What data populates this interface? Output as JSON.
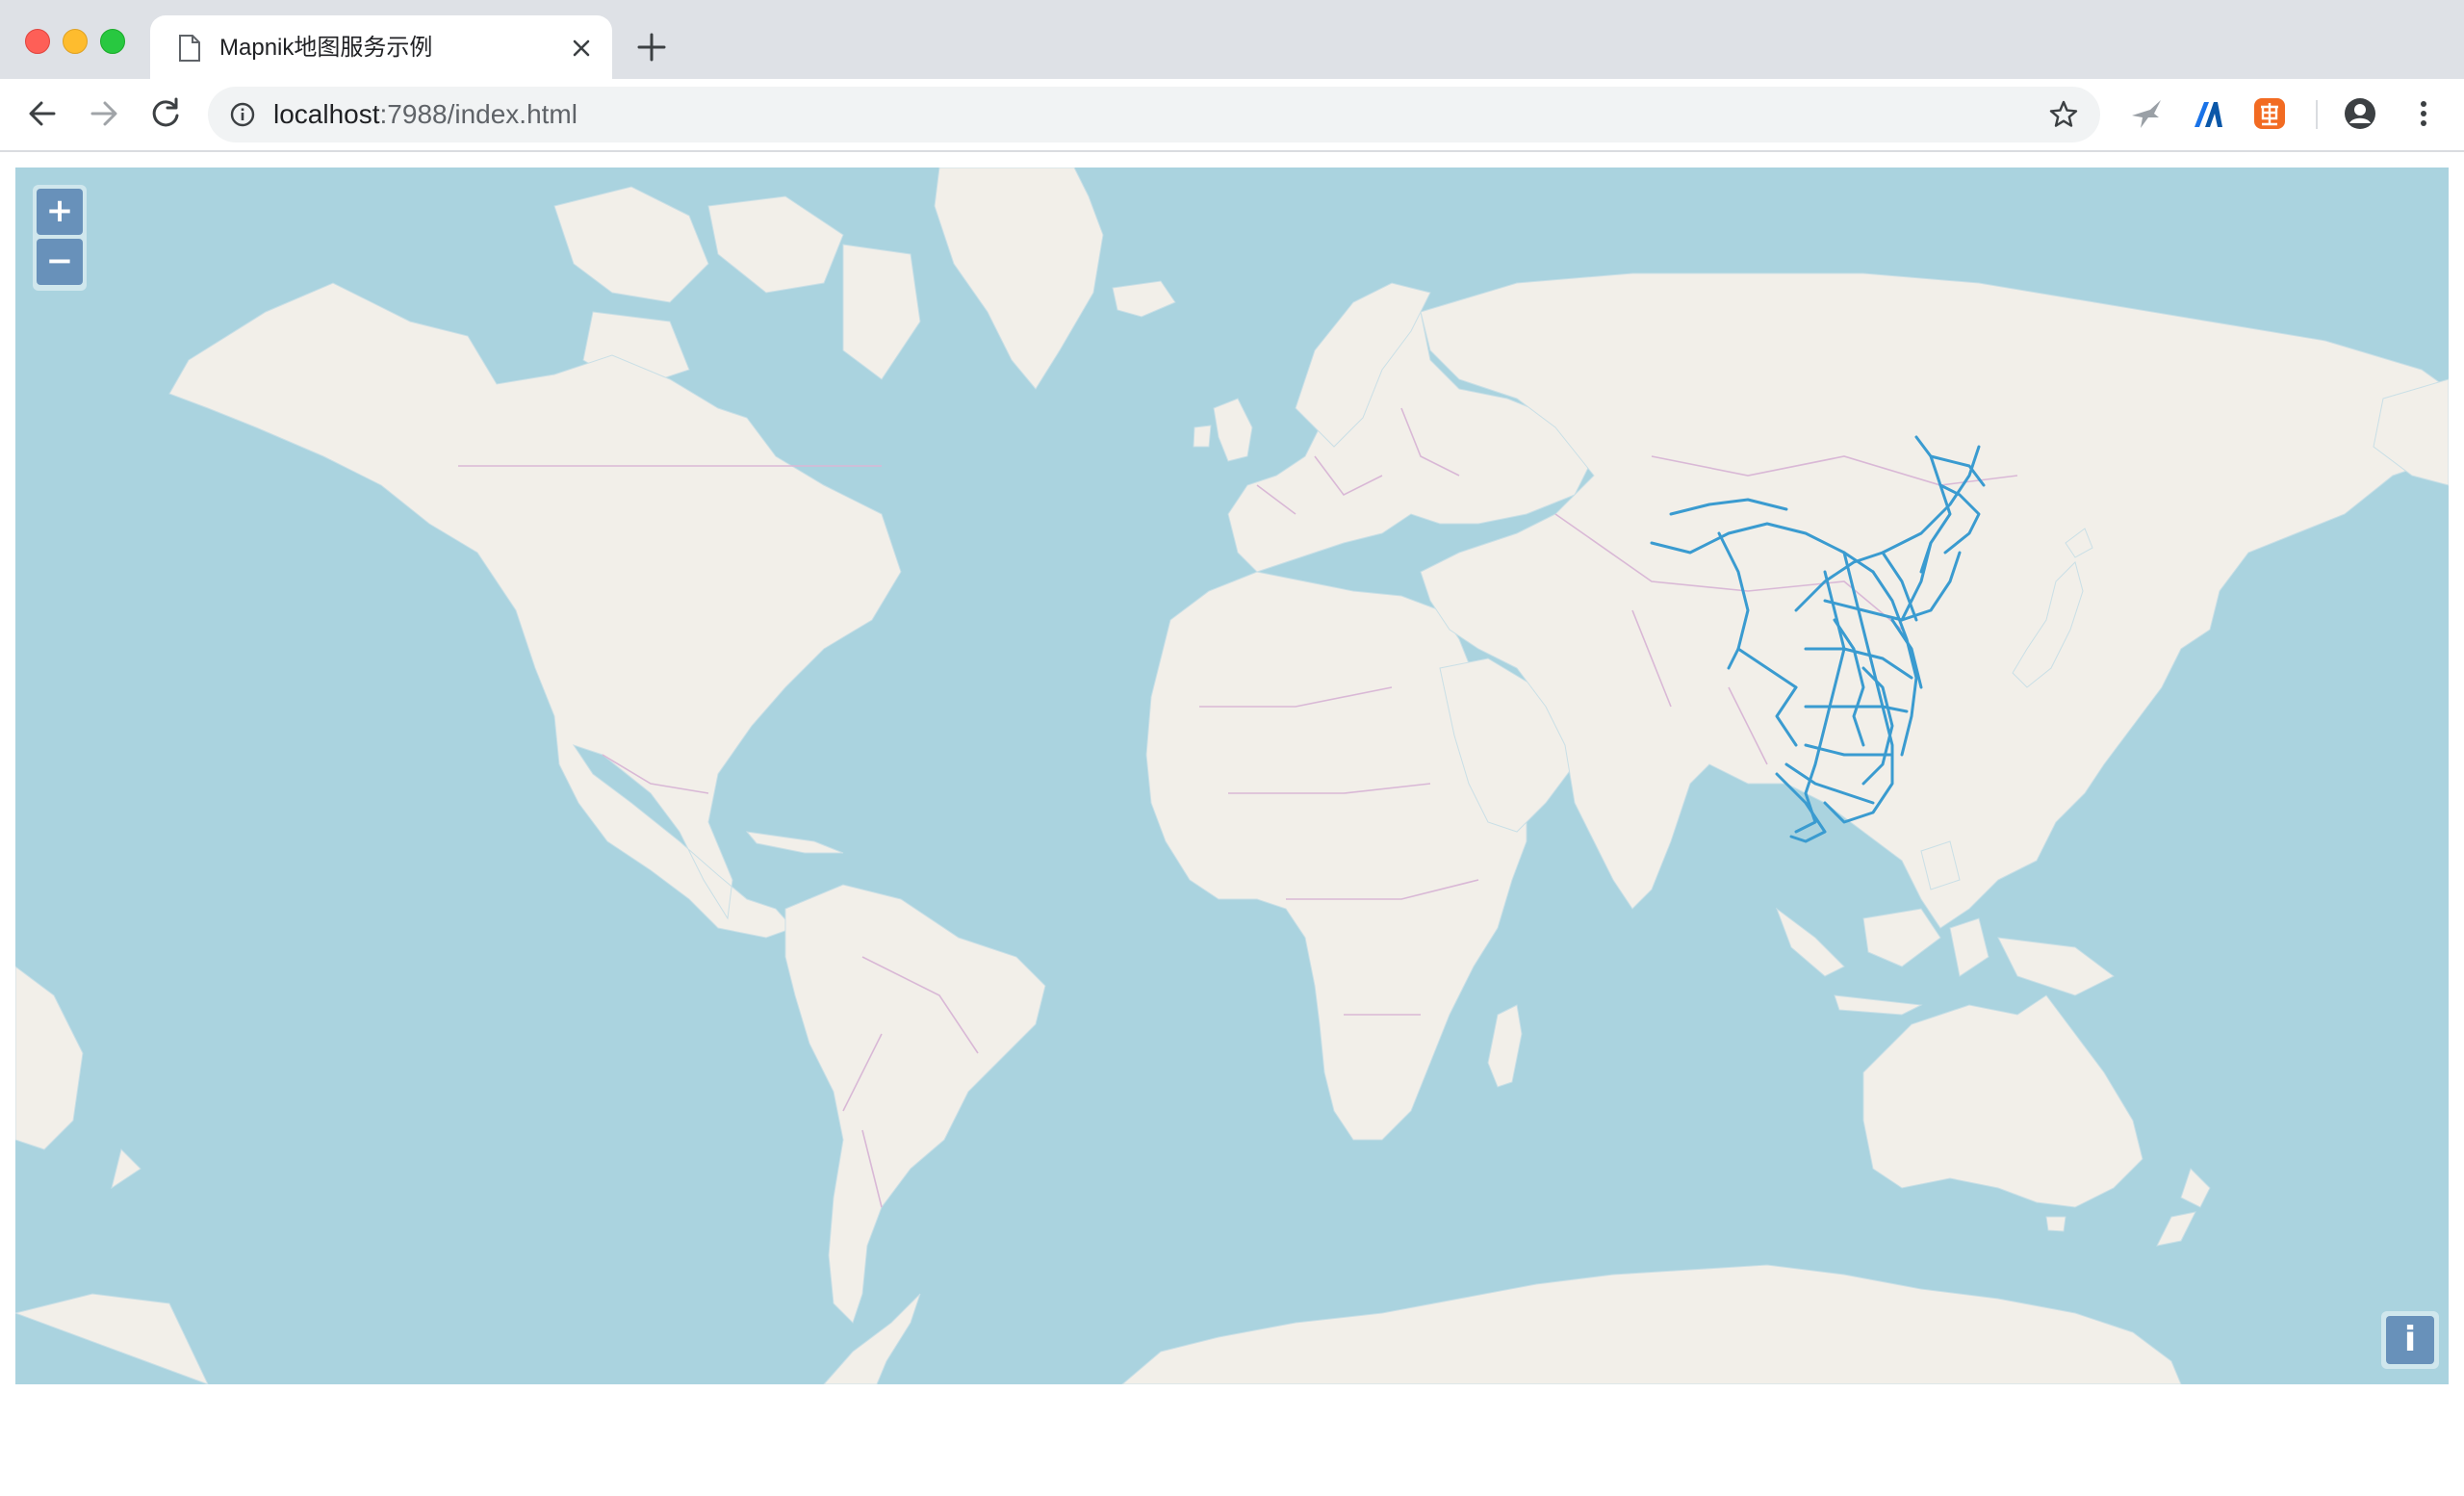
{
  "browser": {
    "tab": {
      "title": "Mapnik地图服务示例",
      "icon": "document-icon"
    },
    "address": {
      "host": "localhost",
      "rest": ":7988/index.html"
    }
  },
  "colors": {
    "water": "#aad3df",
    "land": "#f2efe9",
    "border": "#d9b8d6",
    "railway": "#3a9bd0"
  },
  "map": {
    "zoom_in_label": "+",
    "zoom_out_label": "−",
    "attribution_label": "i"
  }
}
